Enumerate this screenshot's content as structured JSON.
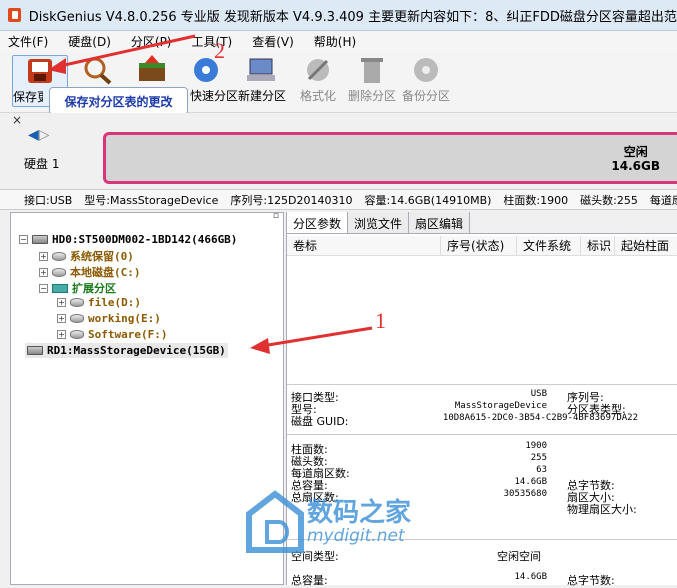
{
  "window": {
    "title": "DiskGenius V4.8.0.256 专业版  发现新版本 V4.9.3.409 主要更新内容如下：8、纠正FDD磁盘分区容量超出范围时显示上"
  },
  "menu": [
    "文件(F)",
    "硬盘(D)",
    "分区(P)",
    "工具(T)",
    "查看(V)",
    "帮助(H)"
  ],
  "toolbar": {
    "buttons": [
      {
        "label": "保存更改",
        "icon": "save-partition-icon"
      },
      {
        "label": "搜索分区",
        "icon": "search-partition-icon"
      },
      {
        "label": "恢复文件",
        "icon": "recover-file-icon"
      },
      {
        "label": "快速分区",
        "icon": "quick-partition-icon"
      },
      {
        "label": "新建分区",
        "icon": "new-partition-icon"
      },
      {
        "label": "格式化",
        "icon": "format-icon"
      },
      {
        "label": "删除分区",
        "icon": "delete-partition-icon"
      },
      {
        "label": "备份分区",
        "icon": "backup-partition-icon"
      }
    ],
    "tooltip": "保存对分区表的更改"
  },
  "disk_strip": {
    "disk_label": "硬盘  1",
    "free_label": "空闲",
    "free_size": "14.6GB"
  },
  "infobar": {
    "interface": "接口:USB",
    "model": "型号:MassStorageDevice",
    "serial": "序列号:125D20140310",
    "capacity": "容量:14.6GB(14910MB)",
    "cylinders": "柱面数:1900",
    "heads": "磁头数:255",
    "sectors": "每道扇区"
  },
  "tree": {
    "hd0": "HD0:ST500DM002-1BD142(466GB)",
    "sys_reserved": "系统保留(0)",
    "local_disk": "本地磁盘(C:)",
    "extended": "扩展分区",
    "file": "file(D:)",
    "working": "working(E:)",
    "software": "Software(F:)",
    "rd1": "RD1:MassStorageDevice(15GB)"
  },
  "tabs": [
    "分区参数",
    "浏览文件",
    "扇区编辑"
  ],
  "grid_columns": [
    "卷标",
    "序号(状态)",
    "文件系统",
    "标识",
    "起始柱面"
  ],
  "details": {
    "interface_type_label": "接口类型:",
    "interface_type": "USB",
    "serial_label": "序列号:",
    "model_label": "型号:",
    "model": "MassStorageDevice",
    "pt_type_label": "分区表类型:",
    "guid_label": "磁盘 GUID:",
    "guid": "10D8A615-2DC0-3B54-C2B9-4BF83697DA22",
    "cylinders_label": "柱面数:",
    "cylinders": "1900",
    "heads_label": "磁头数:",
    "heads": "255",
    "spt_label": "每道扇区数:",
    "spt": "63",
    "capacity_label": "总容量:",
    "capacity": "14.6GB",
    "total_bytes_label": "总字节数:",
    "sectors_label": "总扇区数:",
    "sectors": "30535680",
    "sector_size_label": "扇区大小:",
    "phys_sector_label": "物理扇区大小:",
    "free_type_label": "空间类型:",
    "free_type": "空闲空间",
    "free_cap_label": "总容量:",
    "free_cap": "14.6GB",
    "free_bytes_label": "总字节数:"
  },
  "annotations": {
    "one": "1",
    "two": "2"
  },
  "watermark": {
    "text": "数码之家",
    "url": "mydigit.net"
  },
  "colors": {
    "accent_pink": "#d9357a",
    "arrow_red": "#e03030",
    "tooltip_blue": "#1c3aa8"
  }
}
